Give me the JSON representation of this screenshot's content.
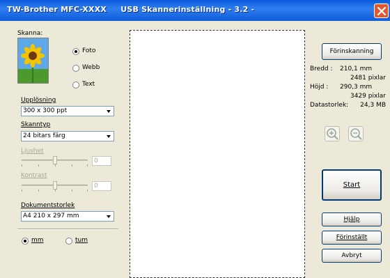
{
  "window": {
    "title": "TW-Brother MFC-XXXX     USB Skannerinställning - 3.2 -"
  },
  "scan": {
    "label": "Skanna:",
    "options": [
      {
        "label": "Foto",
        "selected": true
      },
      {
        "label": "Webb",
        "selected": false
      },
      {
        "label": "Text",
        "selected": false
      }
    ]
  },
  "resolution": {
    "label": "Upplösning",
    "value": "300 x 300 ppt"
  },
  "scantype": {
    "label": "Skanntyp",
    "value": "24 bitars färg"
  },
  "brightness": {
    "label": "Ljushet",
    "value": "0"
  },
  "contrast": {
    "label": "Kontrast",
    "value": "0"
  },
  "docsize": {
    "label": "Dokumentstorlek",
    "value": "A4 210 x 297 mm"
  },
  "units": {
    "mm": "mm",
    "inch": "tum",
    "selected": "mm"
  },
  "info": {
    "width_label": "Bredd :",
    "width_mm": "210,1 mm",
    "width_px": "2481 pixlar",
    "height_label": "Höjd :",
    "height_mm": "290,3 mm",
    "height_px": "3429 pixlar",
    "size_label": "Datastorlek:",
    "size_value": "24,3 MB"
  },
  "buttons": {
    "prescan": "Förinskanning",
    "start": "Start",
    "help": "Hjälp",
    "default": "Förinställt",
    "cancel": "Avbryt"
  }
}
